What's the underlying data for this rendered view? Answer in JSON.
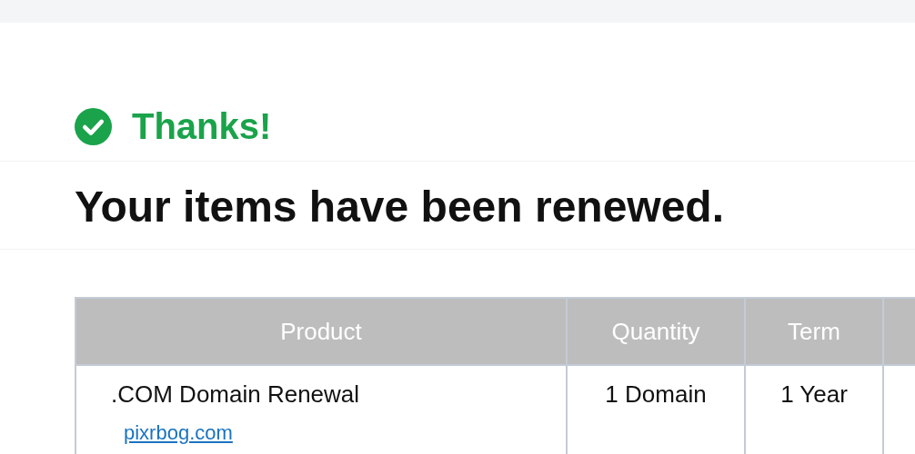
{
  "confirmation": {
    "title": "Thanks!",
    "heading": "Your items have been renewed."
  },
  "table": {
    "columns": [
      "Product",
      "Quantity",
      "Term"
    ],
    "rows": [
      {
        "product": ".COM Domain Renewal",
        "domain": "pixrbog.com",
        "quantity": "1 Domain",
        "term": "1 Year"
      }
    ]
  }
}
